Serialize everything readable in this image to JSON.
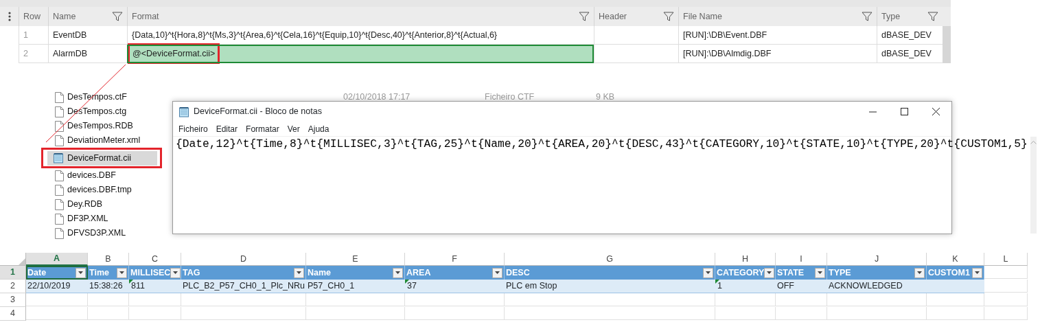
{
  "grid": {
    "columns": [
      {
        "label": "Row",
        "filter": false
      },
      {
        "label": "Name",
        "filter": true
      },
      {
        "label": "Format",
        "filter": true
      },
      {
        "label": "Header",
        "filter": true
      },
      {
        "label": "File Name",
        "filter": true
      },
      {
        "label": "Type",
        "filter": true
      }
    ],
    "rows": [
      {
        "row": "1",
        "name": "EventDB",
        "format": "{Data,10}^t{Hora,8}^t{Ms,3}^t{Area,6}^t{Cela,16}^t{Equip,10}^t{Desc,40}^t{Anterior,8}^t{Actual,6}",
        "file_name": "[RUN]:\\DB\\Event.DBF",
        "type": "dBASE_DEV",
        "selected": false
      },
      {
        "row": "2",
        "name": "AlarmDB",
        "format": "@<DeviceFormat.cii>",
        "file_name": "[RUN]:\\DB\\Almdig.DBF",
        "type": "dBASE_DEV",
        "selected": true
      }
    ]
  },
  "explorer": {
    "details": {
      "date": "02/10/2018 17:17",
      "type": "Ficheiro CTF",
      "size": "9 KB"
    },
    "files": [
      {
        "name": "DesTempos.ctF",
        "kind": "file",
        "selected": false
      },
      {
        "name": "DesTempos.ctg",
        "kind": "file",
        "selected": false
      },
      {
        "name": "DesTempos.RDB",
        "kind": "file",
        "selected": false
      },
      {
        "name": "DeviationMeter.xml",
        "kind": "file",
        "selected": false
      },
      {
        "name": "DeviceFormat.cii",
        "kind": "notepad",
        "selected": true
      },
      {
        "name": "devices.DBF",
        "kind": "file",
        "selected": false
      },
      {
        "name": "devices.DBF.tmp",
        "kind": "file",
        "selected": false
      },
      {
        "name": "Dey.RDB",
        "kind": "file",
        "selected": false
      },
      {
        "name": "DF3P.XML",
        "kind": "file",
        "selected": false
      },
      {
        "name": "DFVSD3P.XML",
        "kind": "file",
        "selected": false
      }
    ]
  },
  "notepad": {
    "title": "DeviceFormat.cii - Bloco de notas",
    "menu": [
      "Ficheiro",
      "Editar",
      "Formatar",
      "Ver",
      "Ajuda"
    ],
    "text": "{Date,12}^t{Time,8}^t{MILLISEC,3}^t{TAG,25}^t{Name,20}^t{AREA,20}^t{DESC,43}^t{CATEGORY,10}^t{STATE,10}^t{TYPE,20}^t{CUSTOM1,5}"
  },
  "spreadsheet": {
    "column_letters": [
      {
        "label": "A",
        "selected": true
      },
      {
        "label": "B",
        "selected": false
      },
      {
        "label": "C",
        "selected": false
      },
      {
        "label": "D",
        "selected": false
      },
      {
        "label": "E",
        "selected": false
      },
      {
        "label": "F",
        "selected": false
      },
      {
        "label": "G",
        "selected": false
      },
      {
        "label": "H",
        "selected": false
      },
      {
        "label": "I",
        "selected": false
      },
      {
        "label": "J",
        "selected": false
      },
      {
        "label": "K",
        "selected": false
      },
      {
        "label": "L",
        "selected": false
      }
    ],
    "row_numbers": [
      {
        "label": "1",
        "selected": true
      },
      {
        "label": "2",
        "selected": false
      },
      {
        "label": "3",
        "selected": false
      },
      {
        "label": "4",
        "selected": false
      }
    ],
    "headers": [
      "Date",
      "Time",
      "MILLISEC",
      "TAG",
      "Name",
      "AREA",
      "DESC",
      "CATEGORY",
      "STATE",
      "TYPE",
      "CUSTOM1"
    ],
    "rows": [
      [
        {
          "value": "22/10/2019",
          "flagged": false
        },
        {
          "value": "15:38:26",
          "flagged": false
        },
        {
          "value": "811",
          "flagged": true
        },
        {
          "value": "PLC_B2_P57_CH0_1_Plc_NRu",
          "flagged": false
        },
        {
          "value": "P57_CH0_1",
          "flagged": false
        },
        {
          "value": "37",
          "flagged": true
        },
        {
          "value": "PLC em Stop",
          "flagged": false
        },
        {
          "value": "1",
          "flagged": true
        },
        {
          "value": "OFF",
          "flagged": false
        },
        {
          "value": "ACKNOWLEDGED",
          "flagged": false
        },
        {
          "flagged": false
        }
      ]
    ]
  }
}
